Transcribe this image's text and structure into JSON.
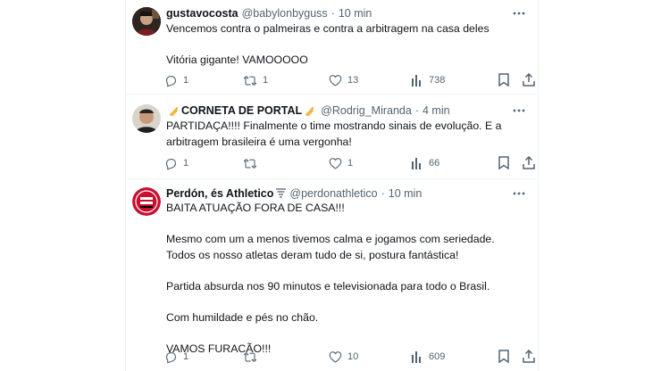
{
  "colors": {
    "text": "#0f1419",
    "muted": "#536471",
    "divider": "#eff3f4"
  },
  "tweets": [
    {
      "name": "gustavocosta",
      "handle": "@babylonbyguss",
      "time": "10 min",
      "lines": [
        "Vencemos contra o palmeiras e contra a arbitragem na casa deles",
        "",
        "Vitória gigante!  VAMOOOOO"
      ],
      "replies": "1",
      "retweets": "1",
      "likes": "13",
      "views": "738"
    },
    {
      "name": "CORNETA DE PORTAL",
      "name_icons": [
        "trumpet-icon",
        "trumpet-icon"
      ],
      "handle": "@Rodrig_Miranda",
      "time": "4 min",
      "lines": [
        "PARTIDAÇA!!!! Finalmente o time mostrando sinais de evolução. E a",
        "arbitragem brasileira é uma vergonha!"
      ],
      "replies": "1",
      "retweets": "",
      "likes": "1",
      "views": "66"
    },
    {
      "name": "Perdón, és Athletico",
      "name_icons": [
        "tornado-icon"
      ],
      "handle": "@perdonathletico",
      "time": "10 min",
      "lines": [
        "BAITA ATUAÇÃO FORA DE CASA!!!",
        "",
        "Mesmo com um a menos tivemos calma e jogamos com seriedade.",
        "Todos os nosso atletas deram tudo de si, postura fantástica!",
        "",
        "Partida absurda nos 90 minutos e televisionada para todo o Brasil.",
        "",
        "Com humildade e pés no chão.",
        "",
        "VAMOS FURACÃO!!!"
      ],
      "replies": "1",
      "retweets": "",
      "likes": "10",
      "views": "609"
    }
  ]
}
